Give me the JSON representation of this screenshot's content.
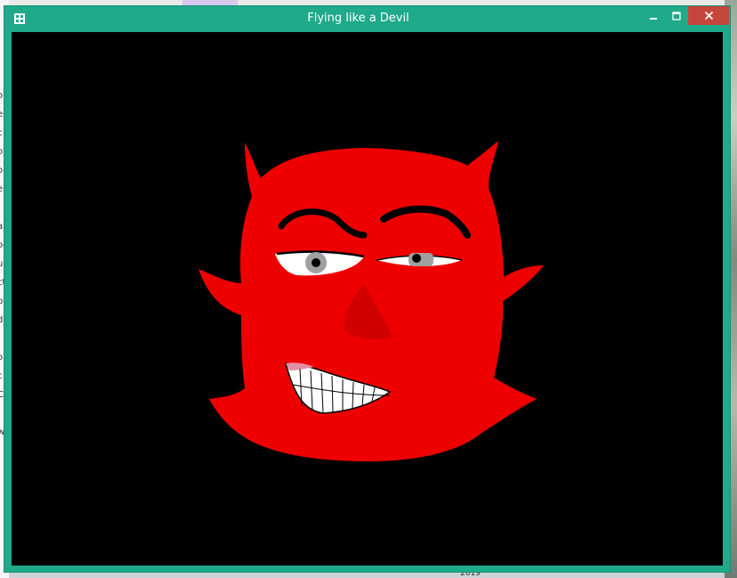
{
  "window": {
    "title": "Flying like a Devil",
    "controls": {
      "minimize_icon": "minimize-icon",
      "maximize_icon": "maximize-icon",
      "close_icon": "close-icon"
    },
    "colors": {
      "titlebar": "#1faa8a",
      "close_button": "#c7463b",
      "client_background": "#000000"
    }
  },
  "canvas": {
    "drawing": "devil-face",
    "colors": {
      "face": "#ee0000",
      "nose": "#d10000",
      "eyebrow": "#000000",
      "eye_white": "#ffffff",
      "iris": "#a0a0a0",
      "pupil": "#000000"
    }
  },
  "desktop": {
    "left_edge_fragments": [
      "or",
      "es",
      "c",
      "o",
      "op",
      "e",
      "ar",
      "oo",
      "ur",
      "ct",
      "b",
      "d",
      "op",
      "c",
      "C",
      "w"
    ],
    "bottom_fragment": "2019"
  }
}
